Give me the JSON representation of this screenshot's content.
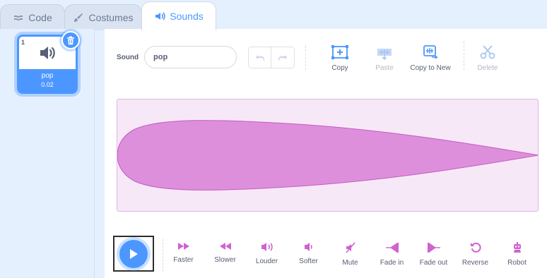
{
  "tabs": [
    {
      "label": "Code",
      "icon": "code-icon"
    },
    {
      "label": "Costumes",
      "icon": "paintbrush-icon"
    },
    {
      "label": "Sounds",
      "icon": "speaker-icon"
    }
  ],
  "sound_list": {
    "items": [
      {
        "number": "1",
        "name": "pop",
        "duration": "0.02"
      }
    ]
  },
  "editor": {
    "sound_label": "Sound",
    "sound_name": "pop",
    "tools": [
      {
        "label": "Copy",
        "icon": "copy-icon"
      },
      {
        "label": "Paste",
        "icon": "paste-icon"
      },
      {
        "label": "Copy to New",
        "icon": "copy-to-new-icon"
      },
      {
        "label": "Delete",
        "icon": "scissors-icon"
      }
    ],
    "effects": [
      {
        "label": "Faster",
        "icon": "faster-icon"
      },
      {
        "label": "Slower",
        "icon": "slower-icon"
      },
      {
        "label": "Louder",
        "icon": "louder-icon"
      },
      {
        "label": "Softer",
        "icon": "softer-icon"
      },
      {
        "label": "Mute",
        "icon": "mute-icon"
      },
      {
        "label": "Fade in",
        "icon": "fade-in-icon"
      },
      {
        "label": "Fade out",
        "icon": "fade-out-icon"
      },
      {
        "label": "Reverse",
        "icon": "reverse-icon"
      },
      {
        "label": "Robot",
        "icon": "robot-icon"
      }
    ]
  },
  "colors": {
    "accent": "#4c97ff",
    "waveform_fill": "#de8fdc",
    "waveform_bg": "#f7e8f8",
    "effect_icon": "#cf63cf"
  }
}
